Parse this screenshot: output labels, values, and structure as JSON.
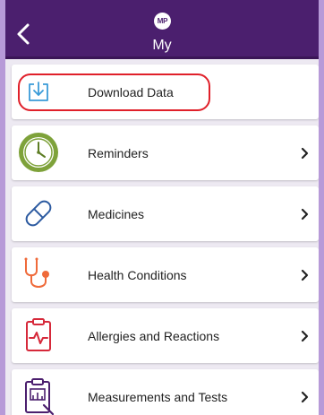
{
  "header": {
    "avatar_initials": "MP",
    "title": "My",
    "back_icon": "chevron-left-icon",
    "bg_color": "#4b1f6e"
  },
  "menu": {
    "items": [
      {
        "label": "Download Data",
        "icon": "download-icon",
        "has_chevron": false,
        "highlighted": true
      },
      {
        "label": "Reminders",
        "icon": "clock-icon",
        "has_chevron": true
      },
      {
        "label": "Medicines",
        "icon": "pill-icon",
        "has_chevron": true
      },
      {
        "label": "Health Conditions",
        "icon": "stethoscope-icon",
        "has_chevron": true
      },
      {
        "label": "Allergies and Reactions",
        "icon": "clipboard-pulse-icon",
        "has_chevron": true
      },
      {
        "label": "Measurements and Tests",
        "icon": "clipboard-chart-icon",
        "has_chevron": true
      }
    ]
  },
  "colors": {
    "accent_frame": "#b79ad8",
    "highlight_ring": "#e0202a",
    "clock_green": "#7ea23a",
    "pill_blue": "#2c5aa0",
    "stetho_orange": "#ef6a3a",
    "clipboard_red": "#d6293a",
    "measure_purple": "#4b1f6e"
  }
}
